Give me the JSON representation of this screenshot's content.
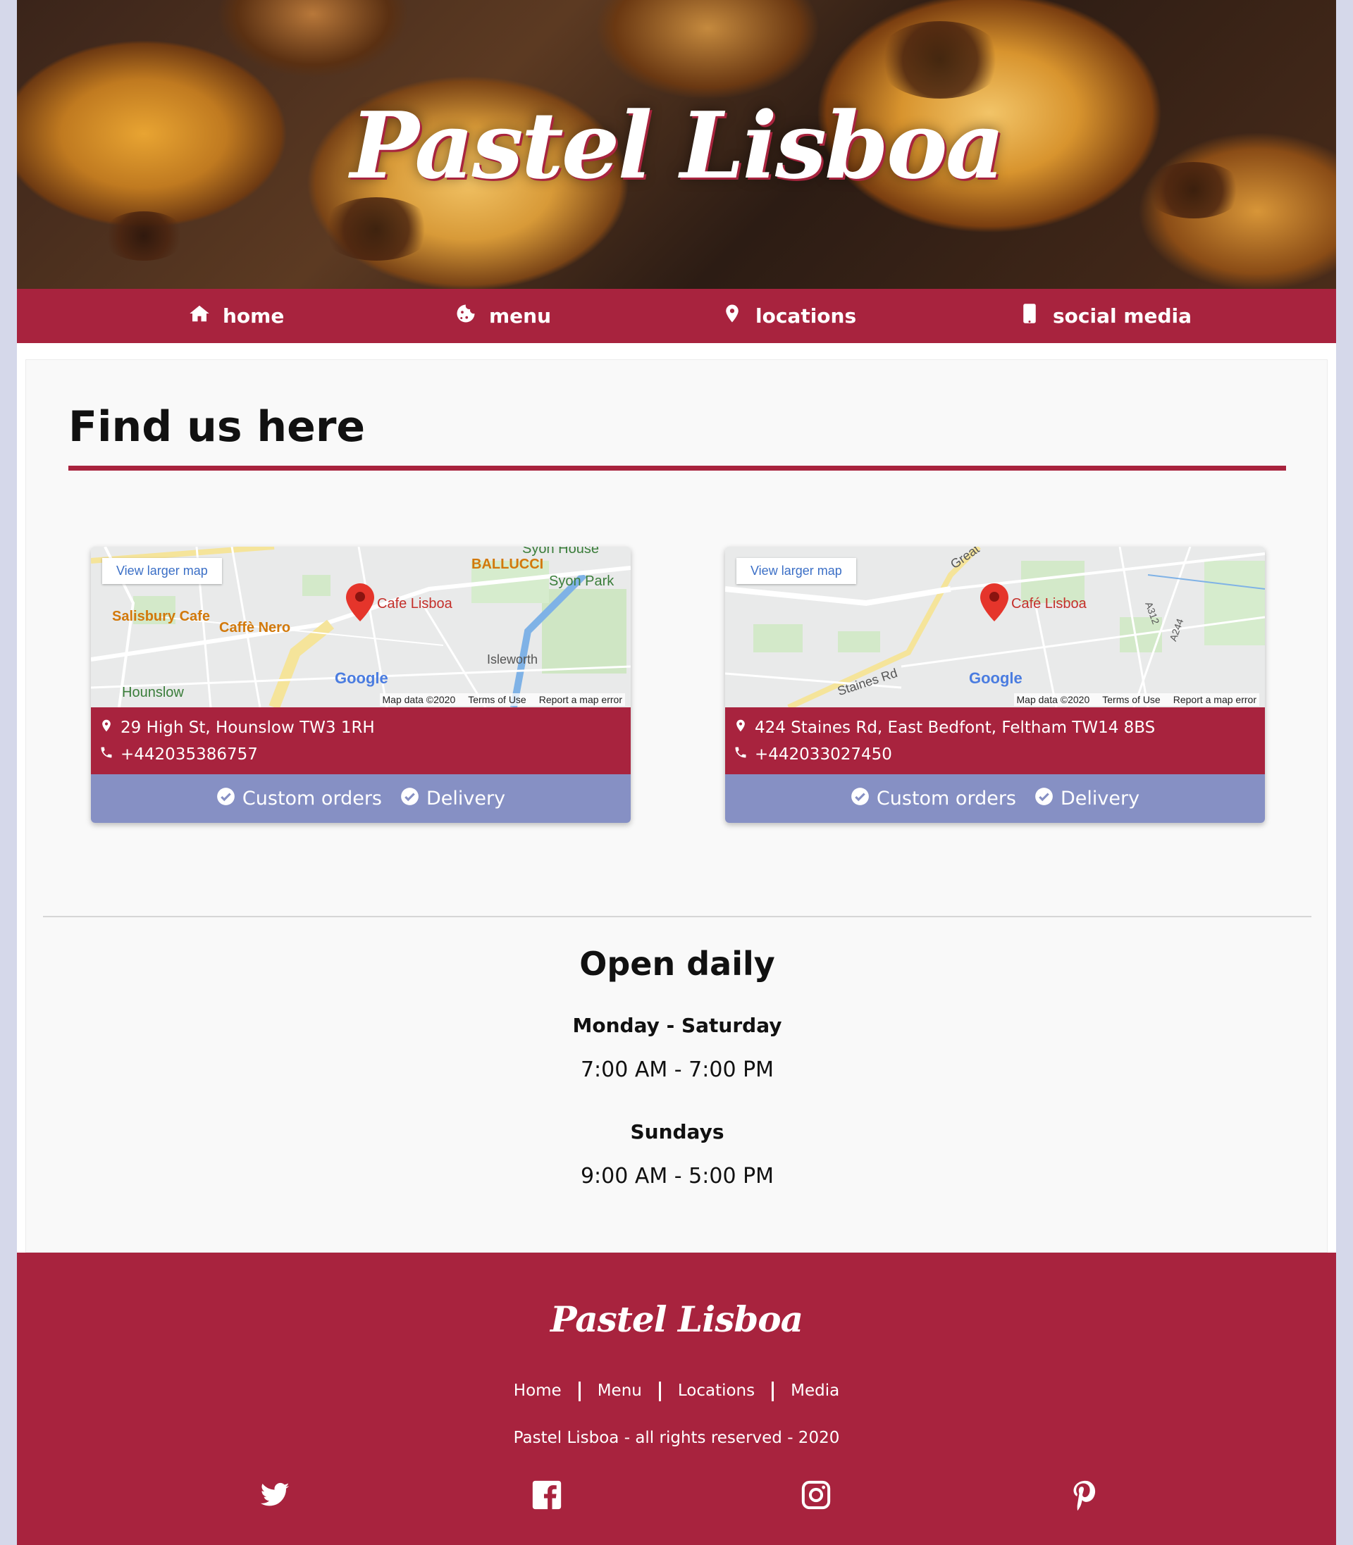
{
  "brand": {
    "name": "Pastel Lisboa",
    "accent": "#a8233e",
    "tag_bg": "#8690c4"
  },
  "nav": {
    "items": [
      {
        "label": "home",
        "icon": "home-icon"
      },
      {
        "label": "menu",
        "icon": "cookie-icon"
      },
      {
        "label": "locations",
        "icon": "map-pin-icon"
      },
      {
        "label": "social media",
        "icon": "mobile-phone-icon"
      }
    ]
  },
  "locations": {
    "heading": "Find us here",
    "cards": [
      {
        "map_button": "View larger map",
        "map_labels": {
          "pin": "Cafe Lisboa",
          "place1": "BALLUCCI",
          "place2": "Syon Park",
          "place3": "Salisbury Cafe",
          "place4": "Caffè Nero",
          "place5": "Isleworth",
          "place6": "Hounslow",
          "place7": "Syon House"
        },
        "map_footer": [
          "Map data ©2020",
          "Terms of Use",
          "Report a map error"
        ],
        "address": "29 High St, Hounslow TW3 1RH",
        "phone": "+442035386757",
        "tags": [
          "Custom orders",
          "Delivery"
        ]
      },
      {
        "map_button": "View larger map",
        "map_labels": {
          "pin": "Café Lisboa",
          "place1": "Staines Rd",
          "place2": "Great",
          "place3": "A312",
          "place4": "A244"
        },
        "map_footer": [
          "Map data ©2020",
          "Terms of Use",
          "Report a map error"
        ],
        "address": "424 Staines Rd, East Bedfont, Feltham TW14 8BS",
        "phone": "+442033027450",
        "tags": [
          "Custom orders",
          "Delivery"
        ]
      }
    ]
  },
  "hours": {
    "title": "Open daily",
    "weekday_label": "Monday - Saturday",
    "weekday_time": "7:00 AM - 7:00 PM",
    "sunday_label": "Sundays",
    "sunday_time": "9:00 AM - 5:00 PM"
  },
  "footer": {
    "brand": "Pastel Lisboa",
    "links": [
      "Home",
      "Menu",
      "Locations",
      "Media"
    ],
    "copyright": "Pastel Lisboa - all rights reserved - 2020",
    "social": [
      "twitter-icon",
      "facebook-icon",
      "instagram-icon",
      "pinterest-icon"
    ]
  },
  "google_logo": "Google"
}
